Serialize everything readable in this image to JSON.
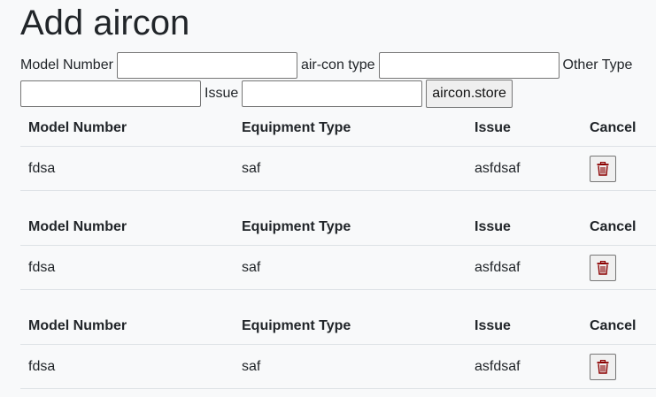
{
  "title": "Add aircon",
  "form": {
    "model_label": "Model Number",
    "model_value": "",
    "type_label": "air-con type",
    "type_value": "",
    "other_label": "Other Type",
    "other_value": "",
    "issue_label": "Issue",
    "issue_value": "",
    "submit_label": "aircon.store"
  },
  "table_headers": [
    "Model Number",
    "Equipment Type",
    "Issue",
    "Cancel"
  ],
  "rows": [
    {
      "model": "fdsa",
      "type": "saf",
      "issue": "asfdsaf",
      "icon": "trash-icon"
    },
    {
      "model": "fdsa",
      "type": "saf",
      "issue": "asfdsaf",
      "icon": "trash-icon"
    },
    {
      "model": "fdsa",
      "type": "saf",
      "issue": "asfdsaf",
      "icon": "trash-icon"
    }
  ],
  "colors": {
    "background": "#f8f9fa",
    "text": "#212529",
    "trash_icon": "#8b0000"
  }
}
